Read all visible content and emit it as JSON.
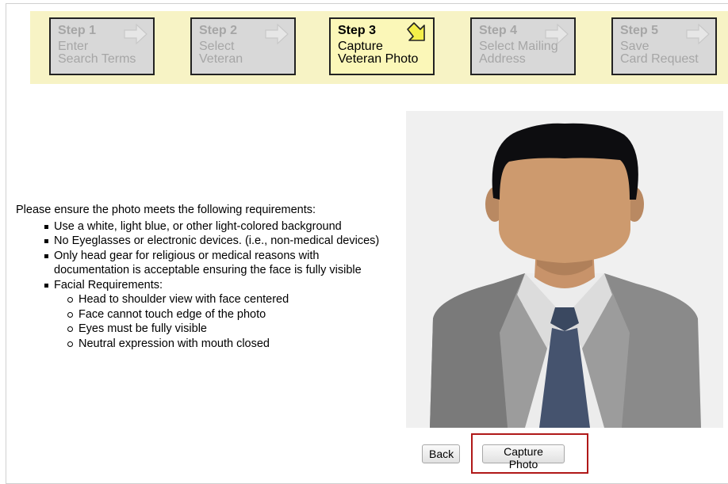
{
  "steps": [
    {
      "num": "Step 1",
      "line1": "Enter",
      "line2": "Search Terms",
      "active": false
    },
    {
      "num": "Step 2",
      "line1": "Select",
      "line2": "Veteran",
      "active": false
    },
    {
      "num": "Step 3",
      "line1": "Capture",
      "line2": "Veteran Photo",
      "active": true
    },
    {
      "num": "Step 4",
      "line1": "Select Mailing",
      "line2": "Address",
      "active": false
    },
    {
      "num": "Step 5",
      "line1": "Save",
      "line2": "Card Request",
      "active": false
    }
  ],
  "requirements": {
    "intro": "Please ensure the photo meets the following requirements:",
    "items": [
      "Use a white, light blue, or other light-colored background",
      "No Eyeglasses or electronic devices. (i.e., non-medical devices)",
      "Only head gear for religious or medical reasons with documentation is acceptable ensuring the face is fully visible",
      "Facial Requirements:"
    ],
    "facial": [
      "Head to shoulder view with face centered",
      "Face cannot touch edge of the photo",
      "Eyes must be fully visible",
      "Neutral expression with mouth closed"
    ]
  },
  "buttons": {
    "back": "Back",
    "capture": "Capture Photo"
  },
  "colors": {
    "steps_bar": "#f7f3c5",
    "step_inactive": "#d8d8d8",
    "step_active": "#fbf7b8",
    "highlight_border": "#b01818"
  }
}
